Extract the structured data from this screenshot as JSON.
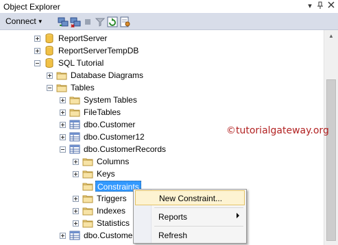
{
  "window": {
    "title": "Object Explorer",
    "pin_glyph": "▾   ↓",
    "close_glyph": "×"
  },
  "toolbar": {
    "connect_label": "Connect",
    "caret": "▾",
    "icons": [
      "connect-object-explorer-icon",
      "disconnect-icon",
      "stop-icon",
      "filter-icon",
      "refresh-icon",
      "summary-icon"
    ]
  },
  "tree": {
    "items": [
      {
        "label": "ReportServer",
        "icon": "database-icon",
        "state": "collapsed"
      },
      {
        "label": "ReportServerTempDB",
        "icon": "database-icon",
        "state": "collapsed"
      },
      {
        "label": "SQL Tutorial",
        "icon": "database-icon",
        "state": "expanded"
      },
      {
        "label": "Database Diagrams",
        "icon": "folder-icon",
        "state": "collapsed"
      },
      {
        "label": "Tables",
        "icon": "folder-icon",
        "state": "expanded"
      },
      {
        "label": "System Tables",
        "icon": "folder-icon",
        "state": "collapsed"
      },
      {
        "label": "FileTables",
        "icon": "folder-icon",
        "state": "collapsed"
      },
      {
        "label": "dbo.Customer",
        "icon": "table-icon",
        "state": "collapsed"
      },
      {
        "label": "dbo.Customer12",
        "icon": "table-icon",
        "state": "collapsed"
      },
      {
        "label": "dbo.CustomerRecords",
        "icon": "table-icon",
        "state": "expanded"
      },
      {
        "label": "Columns",
        "icon": "folder-icon",
        "state": "collapsed"
      },
      {
        "label": "Keys",
        "icon": "folder-icon",
        "state": "collapsed"
      },
      {
        "label": "Constraints",
        "icon": "folder-icon",
        "state": "selected"
      },
      {
        "label": "Triggers",
        "icon": "folder-icon",
        "state": "collapsed"
      },
      {
        "label": "Indexes",
        "icon": "folder-icon",
        "state": "collapsed"
      },
      {
        "label": "Statistics",
        "icon": "folder-icon",
        "state": "collapsed"
      },
      {
        "label": "dbo.Custome",
        "icon": "table-icon",
        "state": "collapsed"
      }
    ]
  },
  "watermark": "©tutorialgateway.org",
  "context_menu": {
    "items": [
      {
        "label": "New Constraint...",
        "highlighted": true
      },
      {
        "label": "Reports",
        "submenu": true
      },
      {
        "label": "Refresh"
      }
    ]
  },
  "colors": {
    "toolbar_bg": "#d8dde9",
    "selection": "#3399ff",
    "menu_hover": "#fdf3d2",
    "watermark": "#b22222"
  }
}
